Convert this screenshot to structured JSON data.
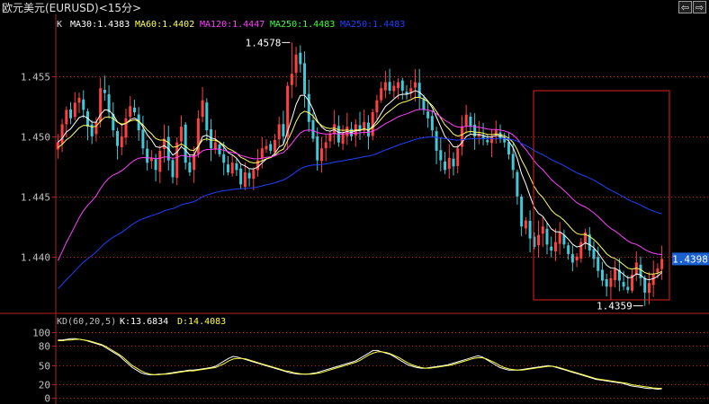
{
  "header": {
    "title": "欧元美元(EURUSD)<15分>"
  },
  "nav": {
    "prev_label": "⇦",
    "next_label": "⇨"
  },
  "colors": {
    "up": "#ff4040",
    "down": "#40c8d8",
    "ma30": "#ffffff",
    "ma60": "#ffff60",
    "ma120": "#ff40ff",
    "ma250a": "#40ff40",
    "ma250b": "#2040ff",
    "grid": "#b02020",
    "box": "#e02020",
    "highlight": "#1a5fd0"
  },
  "chart_data": [
    {
      "type": "candlestick",
      "symbol": "EURUSD",
      "interval": "15分",
      "legend_prefix": "K",
      "indicators": [
        {
          "name": "MA30",
          "label": "MA30:1.4383",
          "value": 1.4383,
          "color": "#ffffff"
        },
        {
          "name": "MA60",
          "label": "MA60:1.4402",
          "value": 1.4402,
          "color": "#ffff60"
        },
        {
          "name": "MA120",
          "label": "MA120:1.4447",
          "value": 1.4447,
          "color": "#ff40ff"
        },
        {
          "name": "MA250",
          "label": "MA250:1.4483",
          "value": 1.4483,
          "color": "#40ff40"
        },
        {
          "name": "MA250",
          "label": "MA250:1.4483",
          "value": 1.4483,
          "color": "#2040ff"
        }
      ],
      "yticks": [
        "1.455",
        "1.450",
        "1.445",
        "1.440"
      ],
      "ytick_values": [
        1.455,
        1.45,
        1.445,
        1.44
      ],
      "ylim": [
        1.4355,
        1.4585
      ],
      "high_label": "1.4578",
      "high_value": 1.4578,
      "high_index": 55,
      "low_label": "1.4359",
      "low_value": 1.4359,
      "low_index": 138,
      "current_label": "1.4398",
      "current_value": 1.4398,
      "closes": [
        1.4495,
        1.451,
        1.4522,
        1.4515,
        1.4528,
        1.4532,
        1.4522,
        1.4508,
        1.45,
        1.4512,
        1.454,
        1.4536,
        1.452,
        1.4505,
        1.4492,
        1.45,
        1.4515,
        1.4525,
        1.452,
        1.4505,
        1.449,
        1.4478,
        1.4482,
        1.4472,
        1.4488,
        1.4498,
        1.448,
        1.4466,
        1.4495,
        1.4508,
        1.4478,
        1.447,
        1.4485,
        1.4515,
        1.453,
        1.4505,
        1.449,
        1.4495,
        1.4485,
        1.4478,
        1.447,
        1.4478,
        1.4472,
        1.446,
        1.447,
        1.4465,
        1.4472,
        1.448,
        1.449,
        1.4492,
        1.4488,
        1.4497,
        1.451,
        1.45,
        1.4542,
        1.4552,
        1.4568,
        1.456,
        1.4535,
        1.4512,
        1.4498,
        1.448,
        1.449,
        1.4495,
        1.4502,
        1.451,
        1.4495,
        1.4502,
        1.4508,
        1.45,
        1.451,
        1.4505,
        1.4512,
        1.45,
        1.452,
        1.453,
        1.454,
        1.4545,
        1.4538,
        1.4542,
        1.4545,
        1.4538,
        1.4535,
        1.454,
        1.4545,
        1.4532,
        1.4522,
        1.4515,
        1.4505,
        1.4488,
        1.448,
        1.4472,
        1.4482,
        1.4475,
        1.449,
        1.4508,
        1.4518,
        1.4508,
        1.45,
        1.4502,
        1.4498,
        1.4495,
        1.45,
        1.4505,
        1.4498,
        1.4495,
        1.4485,
        1.4472,
        1.445,
        1.4425,
        1.443,
        1.4415,
        1.4408,
        1.4418,
        1.4425,
        1.441,
        1.4405,
        1.4412,
        1.442,
        1.441,
        1.4402,
        1.4395,
        1.44,
        1.4412,
        1.442,
        1.4405,
        1.4398,
        1.4388,
        1.438,
        1.4375,
        1.4382,
        1.439,
        1.438,
        1.4375,
        1.4372,
        1.4385,
        1.4395,
        1.4382,
        1.437,
        1.4378,
        1.4385,
        1.439,
        1.4398
      ]
    },
    {
      "type": "line",
      "indicator": "KD(60,20,5)",
      "label": "KD(60,20,5)",
      "series": [
        {
          "name": "K",
          "label": "K:13.6834",
          "last": 13.6834,
          "color": "#ffffff",
          "values": [
            88,
            88,
            89,
            90,
            90,
            89,
            88,
            86,
            84,
            82,
            80,
            76,
            72,
            68,
            64,
            58,
            52,
            46,
            42,
            38,
            36,
            35,
            35,
            36,
            36,
            37,
            38,
            39,
            40,
            41,
            42,
            42,
            43,
            44,
            45,
            46,
            48,
            52,
            56,
            60,
            63,
            62,
            60,
            58,
            56,
            54,
            52,
            50,
            48,
            46,
            44,
            42,
            40,
            38,
            37,
            36,
            36,
            36,
            37,
            38,
            40,
            42,
            44,
            46,
            48,
            50,
            52,
            54,
            56,
            60,
            64,
            68,
            72,
            72,
            70,
            68,
            66,
            62,
            58,
            54,
            50,
            48,
            46,
            45,
            45,
            46,
            47,
            48,
            49,
            50,
            52,
            54,
            56,
            58,
            60,
            62,
            64,
            62,
            58,
            54,
            50,
            46,
            44,
            42,
            42,
            42,
            43,
            44,
            45,
            46,
            47,
            48,
            49,
            48,
            46,
            44,
            42,
            40,
            38,
            36,
            34,
            32,
            30,
            28,
            27,
            26,
            25,
            24,
            23,
            22,
            20,
            18,
            17,
            16,
            15,
            14,
            14,
            13,
            13.6834
          ]
        },
        {
          "name": "D",
          "label": "D:14.4083",
          "last": 14.4083,
          "color": "#ffff40",
          "values": [
            87,
            87,
            88,
            88,
            89,
            89,
            88,
            87,
            85,
            83,
            81,
            78,
            74,
            70,
            66,
            61,
            55,
            49,
            45,
            41,
            38,
            36,
            35,
            35,
            36,
            36,
            37,
            38,
            39,
            40,
            41,
            41,
            42,
            43,
            44,
            45,
            46,
            49,
            52,
            56,
            59,
            60,
            60,
            59,
            57,
            55,
            53,
            51,
            49,
            47,
            45,
            43,
            41,
            40,
            38,
            37,
            36,
            36,
            36,
            37,
            38,
            40,
            42,
            44,
            46,
            48,
            50,
            52,
            54,
            57,
            61,
            65,
            68,
            70,
            70,
            69,
            67,
            64,
            61,
            57,
            53,
            50,
            48,
            46,
            45,
            45,
            46,
            47,
            48,
            49,
            50,
            52,
            54,
            56,
            58,
            60,
            61,
            61,
            59,
            56,
            53,
            49,
            46,
            44,
            43,
            42,
            42,
            43,
            44,
            45,
            46,
            47,
            48,
            48,
            47,
            45,
            43,
            41,
            39,
            37,
            35,
            33,
            31,
            29,
            28,
            27,
            26,
            25,
            24,
            23,
            22,
            20,
            19,
            18,
            17,
            16,
            15,
            14.5,
            14.4083
          ]
        }
      ],
      "yticks": [
        "100",
        "80",
        "50",
        "20",
        "0"
      ],
      "ytick_values": [
        100,
        80,
        50,
        20,
        0
      ],
      "ylim": [
        0,
        100
      ]
    }
  ]
}
